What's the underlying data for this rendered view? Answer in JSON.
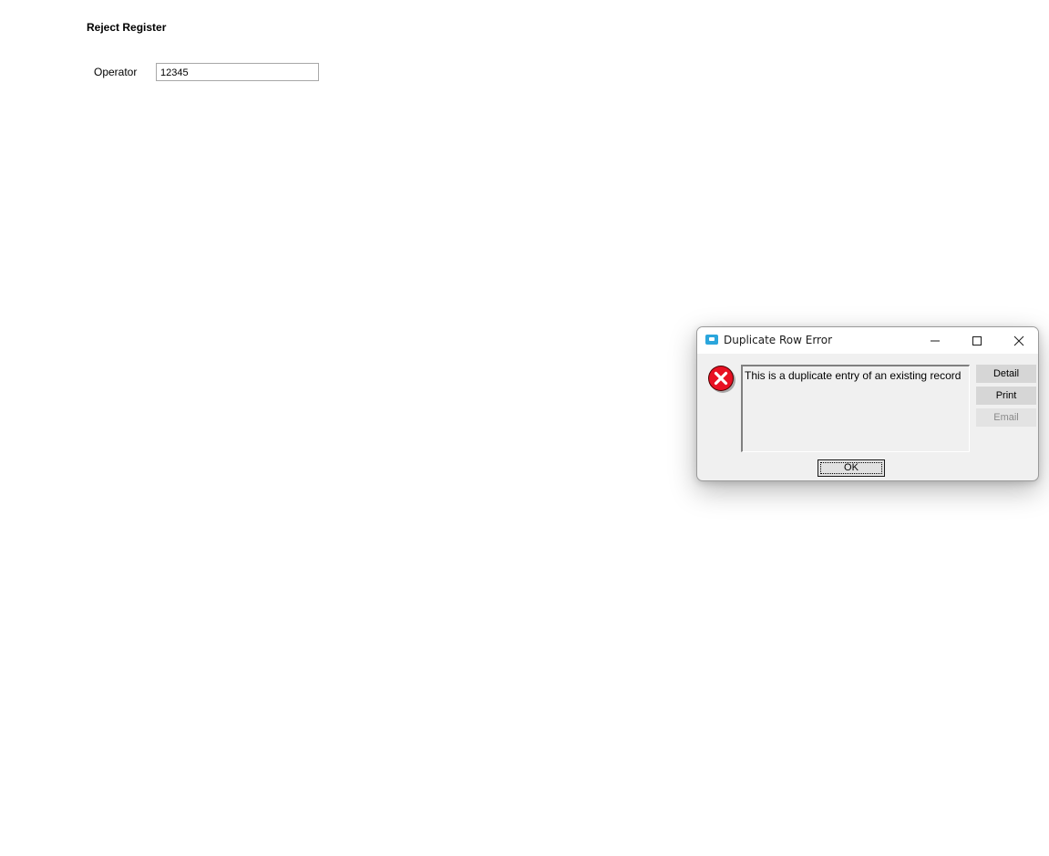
{
  "form": {
    "title": "Reject Register",
    "operator_label": "Operator",
    "operator_value": "12345"
  },
  "dialog": {
    "title": "Duplicate Row Error",
    "app_icon": "app-window-icon",
    "error_icon": "error-x-icon",
    "message": "This is a duplicate entry of an existing record",
    "buttons": {
      "detail": "Detail",
      "print": "Print",
      "email": "Email",
      "ok": "OK"
    },
    "email_enabled": false,
    "colors": {
      "error_red": "#e81123",
      "app_icon": "#2ba6dc"
    }
  }
}
